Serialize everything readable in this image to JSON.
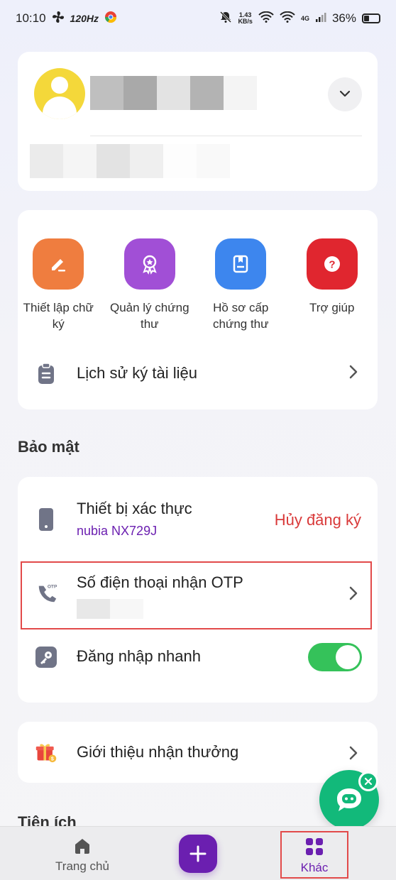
{
  "status_bar": {
    "time": "10:10",
    "refresh_rate": "120Hz",
    "net_speed_value": "1.43",
    "net_speed_unit": "KB/s",
    "network": "4G",
    "battery": "36%",
    "battery_level": 0.36
  },
  "quick_actions": [
    {
      "label": "Thiết lập chữ ký",
      "color": "#ef7d3f",
      "icon": "pen-sign-icon"
    },
    {
      "label": "Quản lý chứng thư",
      "color": "#a14fd6",
      "icon": "certificate-badge-icon"
    },
    {
      "label": "Hồ sơ cấp chứng thư",
      "color": "#3d86ee",
      "icon": "document-bookmark-icon"
    },
    {
      "label": "Trợ giúp",
      "color": "#e0262f",
      "icon": "help-icon"
    }
  ],
  "history": {
    "label": "Lịch sử ký tài liệu"
  },
  "security": {
    "section_title": "Bảo mật",
    "auth_device": {
      "title": "Thiết bị xác thực",
      "device": "nubia NX729J",
      "action": "Hủy đăng ký"
    },
    "otp_phone": {
      "title": "Số điện thoại nhận OTP",
      "icon_label": "OTP"
    },
    "quick_login": {
      "title": "Đăng nhập nhanh",
      "enabled": true
    }
  },
  "referral": {
    "label": "Giới thiệu nhận thưởng"
  },
  "utilities": {
    "section_title": "Tiện ích"
  },
  "nav": {
    "home": "Trang chủ",
    "more": "Khác"
  },
  "colors": {
    "accent_purple": "#6b1fb0",
    "danger": "#d93a3a",
    "toggle_on": "#35c25a",
    "chat_green": "#12b97a"
  }
}
